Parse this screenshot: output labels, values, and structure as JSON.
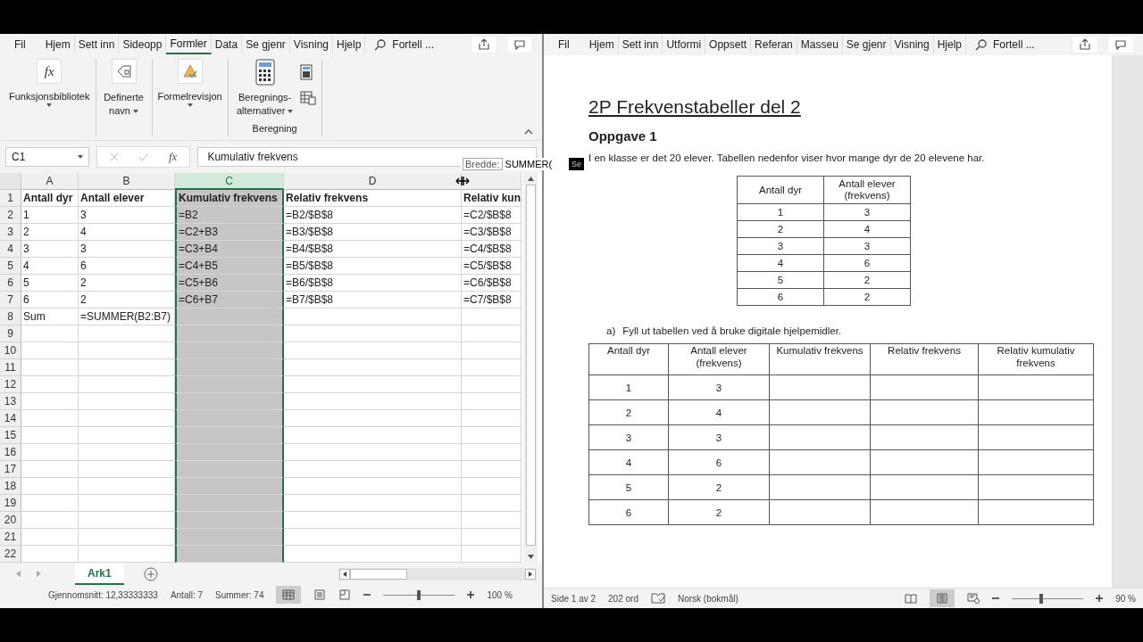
{
  "excel": {
    "tabs": [
      {
        "label": "Fil",
        "selected": false
      },
      {
        "label": "Hjem",
        "selected": false
      },
      {
        "label": "Sett inn",
        "selected": false
      },
      {
        "label": "Sideopp",
        "selected": false
      },
      {
        "label": "Formler",
        "selected": true
      },
      {
        "label": "Data",
        "selected": false
      },
      {
        "label": "Se gjenr",
        "selected": false
      },
      {
        "label": "Visning",
        "selected": false
      },
      {
        "label": "Hjelp",
        "selected": false
      }
    ],
    "search": "Fortell ...",
    "ribbon": {
      "groups": [
        {
          "kind": "function",
          "label": "Funksjonsbibliotek",
          "icon_text": "fx"
        },
        {
          "kind": "names",
          "label": "Definerte navn"
        },
        {
          "kind": "audit",
          "label": "Formelrevisjon"
        },
        {
          "kind": "calc",
          "label": "Beregnings-alternativer",
          "group_label": "Beregning"
        }
      ]
    },
    "name_box": "C1",
    "insert_function": "fx",
    "formula": "Kumulativ frekvens",
    "tooltip": {
      "label": "Bredde:",
      "text": "SUMMER(",
      "badge": "Se"
    },
    "columns": [
      {
        "label": "A",
        "selected": false
      },
      {
        "label": "B",
        "selected": false
      },
      {
        "label": "C",
        "selected": true
      },
      {
        "label": "D",
        "selected": false
      },
      {
        "selected": false
      }
    ],
    "rows": [
      {
        "number": "1",
        "kind": "header",
        "cells": [
          "Antall dyr",
          "Antall elever",
          "Kumulativ frekvens",
          "Relativ frekvens",
          "Relativ kun"
        ]
      },
      {
        "number": "2",
        "cells": [
          "1",
          "3",
          "=B2",
          "=B2/$B$8",
          "=C2/$B$8"
        ]
      },
      {
        "number": "3",
        "cells": [
          "2",
          "4",
          "=C2+B3",
          "=B3/$B$8",
          "=C3/$B$8"
        ]
      },
      {
        "number": "4",
        "cells": [
          "3",
          "3",
          "=C3+B4",
          "=B4/$B$8",
          "=C4/$B$8"
        ]
      },
      {
        "number": "5",
        "cells": [
          "4",
          "6",
          "=C4+B5",
          "=B5/$B$8",
          "=C5/$B$8"
        ]
      },
      {
        "number": "6",
        "cells": [
          "5",
          "2",
          "=C5+B6",
          "=B6/$B$8",
          "=C6/$B$8"
        ]
      },
      {
        "number": "7",
        "cells": [
          "6",
          "2",
          "=C6+B7",
          "=B7/$B$8",
          "=C7/$B$8"
        ]
      },
      {
        "number": "8",
        "cells": [
          "Sum",
          "=SUMMER(B2:B7)",
          null,
          null,
          null
        ]
      },
      {
        "number": "9"
      },
      {
        "number": "10"
      },
      {
        "number": "11"
      },
      {
        "number": "12"
      },
      {
        "number": "13"
      },
      {
        "number": "14"
      },
      {
        "number": "15"
      },
      {
        "number": "16"
      },
      {
        "number": "17"
      },
      {
        "number": "18"
      },
      {
        "number": "19"
      },
      {
        "number": "20"
      },
      {
        "number": "21"
      },
      {
        "number": "22"
      }
    ],
    "sheets": [
      {
        "label": "Ark1",
        "selected": true
      }
    ],
    "status": [
      "Gjennomsnitt: 12,33333333",
      "Antall: 7",
      "Summer: 74"
    ],
    "zoom": {
      "level": 0.5,
      "reading": "100 %"
    }
  },
  "word": {
    "tabs": [
      {
        "label": "Fil",
        "selected": false
      },
      {
        "label": "Hjem",
        "selected": false
      },
      {
        "label": "Sett inn",
        "selected": false
      },
      {
        "label": "Utformi",
        "selected": false
      },
      {
        "label": "Oppsett",
        "selected": false
      },
      {
        "label": "Referan",
        "selected": false
      },
      {
        "label": "Masseu",
        "selected": false
      },
      {
        "label": "Se gjenr",
        "selected": false
      },
      {
        "label": "Visning",
        "selected": false
      },
      {
        "label": "Hjelp",
        "selected": false
      }
    ],
    "search": "Fortell ...",
    "title": "2P Frekvenstabeller del 2",
    "heading": "Oppgave 1",
    "paragraph": "I en klasse er det 20 elever. Tabellen nedenfor viser hvor mange dyr de 20 elevene har.",
    "table1": {
      "columns": [
        "Antall dyr",
        "Antall elever (frekvens)"
      ],
      "rows": [
        [
          "1",
          "3"
        ],
        [
          "2",
          "4"
        ],
        [
          "3",
          "3"
        ],
        [
          "4",
          "6"
        ],
        [
          "5",
          "2"
        ],
        [
          "6",
          "2"
        ]
      ]
    },
    "task": {
      "marker": "a)",
      "text": "Fyll ut tabellen ved å bruke digitale hjelpemidler."
    },
    "table2": {
      "columns": [
        "Antall dyr",
        "Antall elever (frekvens)",
        "Kumulativ frekvens",
        "Relativ frekvens",
        "Relativ kumulativ frekvens"
      ],
      "rows": [
        [
          "1",
          "3"
        ],
        [
          "2",
          "4"
        ],
        [
          "3",
          "3"
        ],
        [
          "4",
          "6"
        ],
        [
          "5",
          "2"
        ],
        [
          "6",
          "2"
        ]
      ]
    },
    "status": [
      "Side 1 av 2",
      "202 ord",
      "Norsk (bokmål)"
    ],
    "zoom": {
      "level": 0.4,
      "reading": "90 %"
    }
  }
}
